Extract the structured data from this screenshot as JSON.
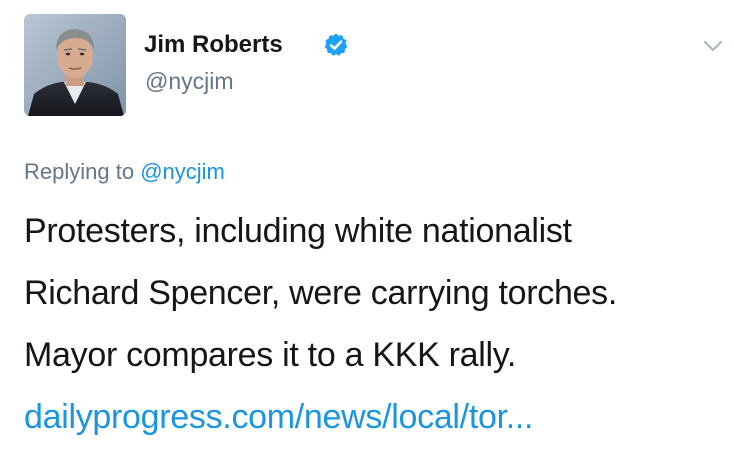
{
  "author": {
    "name": "Jim Roberts",
    "handle": "@nycjim",
    "verified": true,
    "avatar_icon": "profile-photo-man-in-suit"
  },
  "reply": {
    "prefix": "Replying to",
    "mention": "@nycjim"
  },
  "tweet": {
    "lines": [
      "Protesters, including white nationalist",
      "Richard Spencer, were carrying torches.",
      "Mayor compares it to a KKK rally."
    ],
    "link_text": "dailyprogress.com/news/local/tor..."
  },
  "icons": {
    "verified": "verified-badge-icon",
    "menu": "chevron-down-icon"
  },
  "colors": {
    "text": "#14171a",
    "secondary": "#657786",
    "link": "#1b95e0",
    "verified": "#1da1f2",
    "chevron": "#aab8c2"
  }
}
